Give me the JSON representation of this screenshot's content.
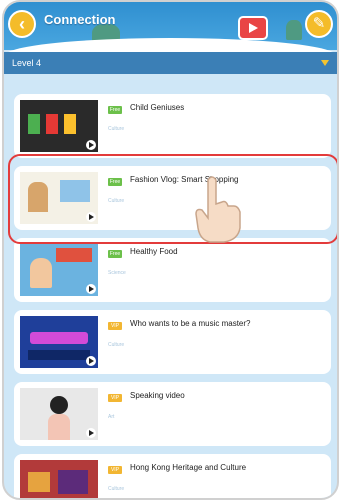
{
  "header": {
    "title": "Connection",
    "back_icon": "chevron-left-icon",
    "tv_icon": "tv-play-icon",
    "settings_icon": "wrench-icon"
  },
  "level": {
    "label": "Level 4"
  },
  "videos": [
    {
      "badge": "Free",
      "title": "Child Geniuses",
      "category": "Culture"
    },
    {
      "badge": "Free",
      "title": "Fashion Vlog: Smart Shopping",
      "category": "Culture"
    },
    {
      "badge": "Free",
      "title": "Healthy Food",
      "category": "Science"
    },
    {
      "badge": "VIP",
      "title": "Who wants to be a music master?",
      "category": "Culture"
    },
    {
      "badge": "VIP",
      "title": "Speaking video",
      "category": "Art"
    },
    {
      "badge": "VIP",
      "title": "Hong Kong Heritage and Culture",
      "category": "Culture"
    }
  ],
  "colors": {
    "highlight": "#e33b3b",
    "free": "#6cc04a",
    "vip": "#f2b632",
    "header": "#2f8fd0"
  }
}
